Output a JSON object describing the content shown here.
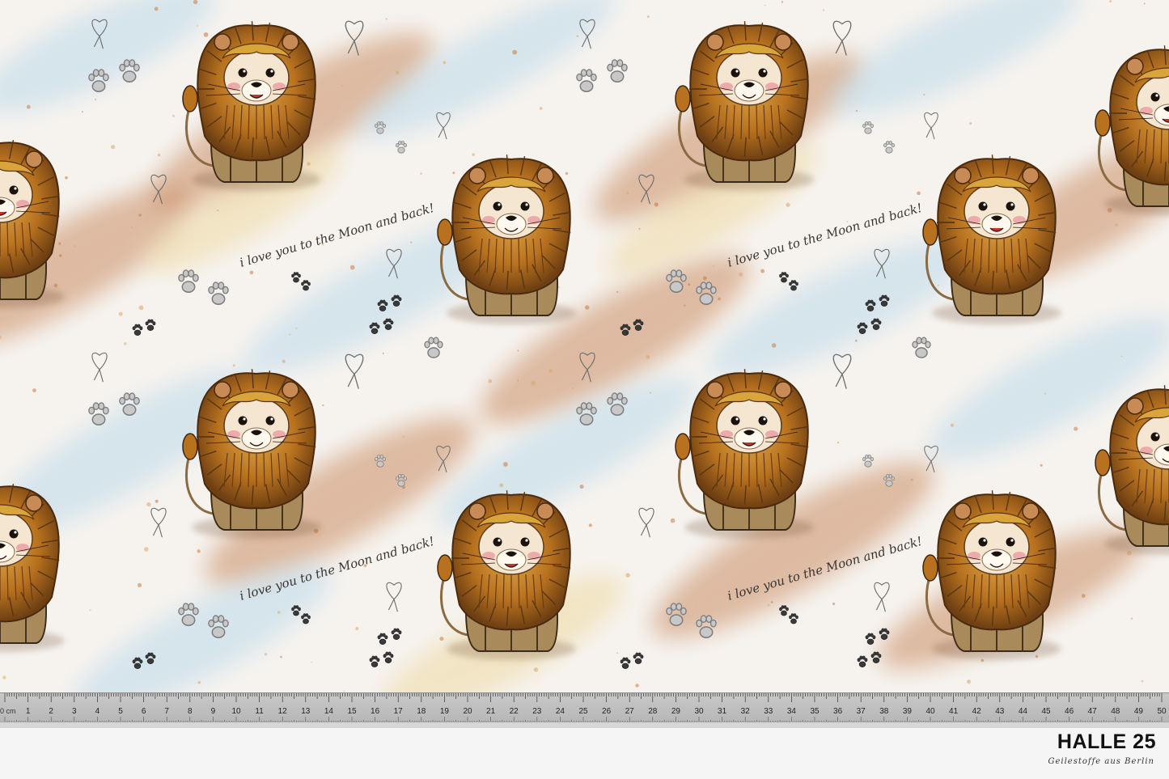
{
  "pattern": {
    "motif": "lion-cub",
    "handwriting": "i love you to the Moon and back!",
    "colors": {
      "mane": "#b8721f",
      "mane_light": "#d9a53a",
      "face": "#f4e6d0",
      "body": "#a98a5b",
      "watercolor_blue": "#bcd9ea",
      "watercolor_rust": "#c98c62",
      "watercolor_yellow": "#eed9a1",
      "paw": "#9a9a9a"
    }
  },
  "ruler": {
    "unit_label": "0 cm",
    "marks": [
      "1",
      "2",
      "3",
      "4",
      "5",
      "6",
      "7",
      "8",
      "9",
      "10",
      "11",
      "12",
      "13",
      "14",
      "15",
      "16",
      "17",
      "18",
      "19",
      "20",
      "21",
      "22",
      "23",
      "24",
      "25",
      "26",
      "27",
      "28",
      "29",
      "30",
      "31",
      "32",
      "33",
      "34",
      "35",
      "36",
      "37",
      "38",
      "39",
      "40",
      "41",
      "42",
      "43",
      "44",
      "45",
      "46",
      "47",
      "48",
      "49",
      "50"
    ]
  },
  "brand": {
    "name": "HALLE 25",
    "tagline": "Geilestoffe aus Berlin"
  }
}
